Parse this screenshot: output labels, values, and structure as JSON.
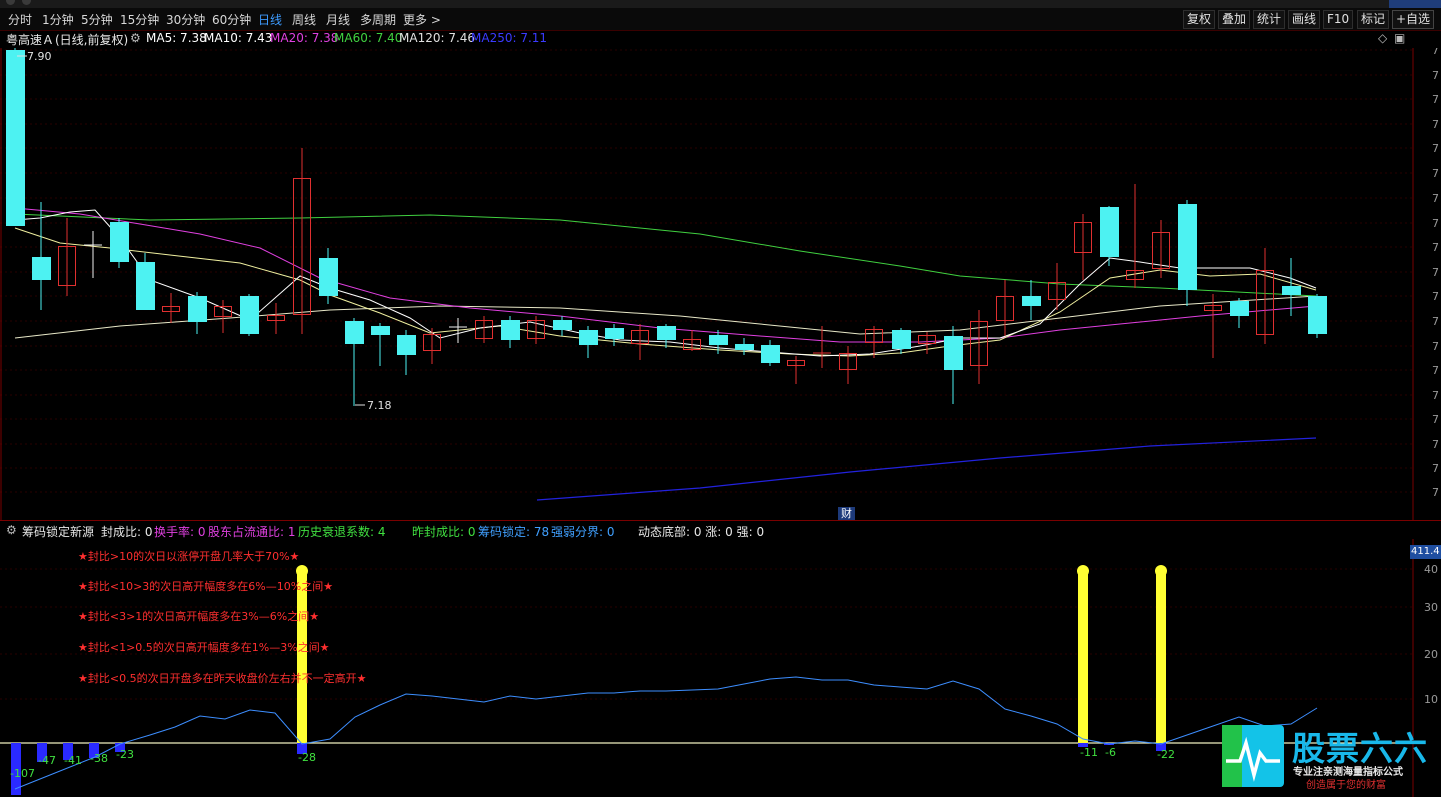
{
  "toolbar": {
    "periods": [
      "分时",
      "1分钟",
      "5分钟",
      "15分钟",
      "30分钟",
      "60分钟",
      "日线",
      "周线",
      "月线",
      "多周期",
      "更多 >"
    ],
    "active_period": "日线",
    "tools": [
      "复权",
      "叠加",
      "统计",
      "画线",
      "F10",
      "标记",
      "+自选"
    ]
  },
  "stock": {
    "name": "粤高速Ａ",
    "mode": "(日线,前复权)",
    "ma": [
      {
        "label": "MA5: 7.38",
        "color": "#ffffff"
      },
      {
        "label": "MA10: 7.43",
        "color": "#ffffff"
      },
      {
        "label": "MA20: 7.38",
        "color": "#e040e0"
      },
      {
        "label": "MA60: 7.40",
        "color": "#40d040"
      },
      {
        "label": "MA120: 7.46",
        "color": "#e0e0e0"
      },
      {
        "label": "MA250: 7.11",
        "color": "#3a3aff"
      }
    ],
    "high_label": "7.90",
    "low_label": "7.18",
    "finance_marker": "财",
    "right_axis_glyph": "7"
  },
  "indicator": {
    "name": "筹码锁定新源",
    "fields": [
      {
        "label": "封成比: 0",
        "color": "#e8e8e8"
      },
      {
        "label": "换手率: 0",
        "color": "#e040e0"
      },
      {
        "label": "股东占流通比: 1",
        "color": "#e040e0"
      },
      {
        "label": "历史衰退系数: 4",
        "color": "#40e040"
      },
      {
        "label": "昨封成比: 0",
        "color": "#40e040"
      },
      {
        "label": "筹码锁定: 78",
        "color": "#40a0ff"
      },
      {
        "label": "强弱分界: 0",
        "color": "#40a0ff"
      },
      {
        "label": "动态底部: 0 涨: 0 强: 0",
        "color": "#e8e8e8"
      }
    ],
    "notes": [
      "★封比>10的次日以涨停开盘几率大于70%★",
      "★封比<10>3的次日高开幅度多在6%—10%之间★",
      "★封比<3>1的次日高开幅度多在3%—6%之间★",
      "★封比<1>0.5的次日高开幅度多在1%—3%之间★",
      "★封比<0.5的次日开盘多在昨天收盘价左右并不一定高开★"
    ],
    "axis": [
      "40",
      "30",
      "20",
      "10"
    ],
    "badge": "411.4",
    "value_labels": [
      "-107",
      "-47",
      "-41",
      "-38",
      "-23",
      "-28",
      "-11",
      "-6",
      "-22"
    ]
  },
  "brand": {
    "name": "股票六六",
    "line1": "专业注亲测海量指标公式",
    "line2": "创造属于您的财富"
  }
}
